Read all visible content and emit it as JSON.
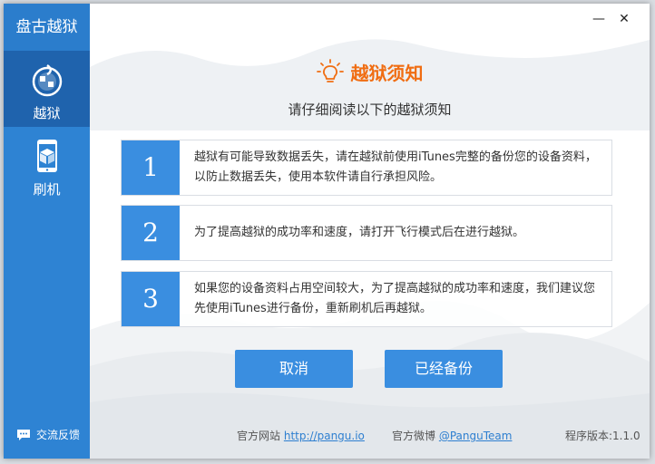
{
  "app": {
    "title": "盘古越狱"
  },
  "sidebar": {
    "items": [
      {
        "label": "越狱",
        "icon": "pangu-logo-icon",
        "active": true
      },
      {
        "label": "刷机",
        "icon": "phone-box-icon",
        "active": false
      }
    ],
    "feedback": "交流反馈"
  },
  "window": {
    "minimize": "—",
    "close": "✕"
  },
  "header": {
    "title": "越狱须知",
    "subtitle": "请仔细阅读以下的越狱须知"
  },
  "notices": [
    {
      "num": "1",
      "text": "越狱有可能导致数据丢失，请在越狱前使用iTunes完整的备份您的设备资料，以防止数据丢失，使用本软件请自行承担风险。"
    },
    {
      "num": "2",
      "text": "为了提高越狱的成功率和速度，请打开飞行模式后在进行越狱。"
    },
    {
      "num": "3",
      "text": "如果您的设备资料占用空间较大，为了提高越狱的成功率和速度，我们建议您先使用iTunes进行备份，重新刷机后再越狱。"
    }
  ],
  "buttons": {
    "cancel": "取消",
    "backed_up": "已经备份"
  },
  "footer": {
    "site_label": "官方网站",
    "site_link": "http://pangu.io",
    "weibo_label": "官方微博",
    "weibo_link": "@PanguTeam",
    "version": "程序版本:1.1.0"
  },
  "colors": {
    "sidebar": "#2e83d3",
    "accent": "#3a8ee0",
    "title": "#f06d12"
  }
}
